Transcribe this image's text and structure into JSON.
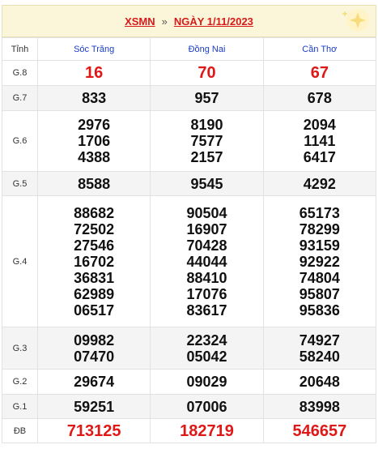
{
  "header": {
    "region": "XSMN",
    "separator": "»",
    "date_link": "NGÀY 1/11/2023"
  },
  "columns": {
    "label": "Tỉnh",
    "provinces": [
      "Sóc Trăng",
      "Đồng Nai",
      "Cần Thơ"
    ]
  },
  "prizes": [
    {
      "name": "G.8",
      "values": [
        [
          "16"
        ],
        [
          "70"
        ],
        [
          "67"
        ]
      ],
      "style": "red"
    },
    {
      "name": "G.7",
      "values": [
        [
          "833"
        ],
        [
          "957"
        ],
        [
          "678"
        ]
      ]
    },
    {
      "name": "G.6",
      "values": [
        [
          "2976",
          "1706",
          "4388"
        ],
        [
          "8190",
          "7577",
          "2157"
        ],
        [
          "2094",
          "1141",
          "6417"
        ]
      ]
    },
    {
      "name": "G.5",
      "values": [
        [
          "8588"
        ],
        [
          "9545"
        ],
        [
          "4292"
        ]
      ]
    },
    {
      "name": "G.4",
      "values": [
        [
          "88682",
          "72502",
          "27546",
          "16702",
          "36831",
          "62989",
          "06517"
        ],
        [
          "90504",
          "16907",
          "70428",
          "44044",
          "88410",
          "17076",
          "83617"
        ],
        [
          "65173",
          "78299",
          "93159",
          "92922",
          "74804",
          "95807",
          "95836"
        ]
      ]
    },
    {
      "name": "G.3",
      "values": [
        [
          "09982",
          "07470"
        ],
        [
          "22324",
          "05042"
        ],
        [
          "74927",
          "58240"
        ]
      ]
    },
    {
      "name": "G.2",
      "values": [
        [
          "29674"
        ],
        [
          "09029"
        ],
        [
          "20648"
        ]
      ]
    },
    {
      "name": "G.1",
      "values": [
        [
          "59251"
        ],
        [
          "07006"
        ],
        [
          "83998"
        ]
      ]
    },
    {
      "name": "ĐB",
      "values": [
        [
          "713125"
        ],
        [
          "182719"
        ],
        [
          "546657"
        ]
      ],
      "style": "red"
    }
  ],
  "colors": {
    "red": "#e01717",
    "blue": "#1a3cc8",
    "header_bg": "#fbf6d9"
  },
  "icons": {
    "header_decoration": "star-sparkle-icon"
  }
}
